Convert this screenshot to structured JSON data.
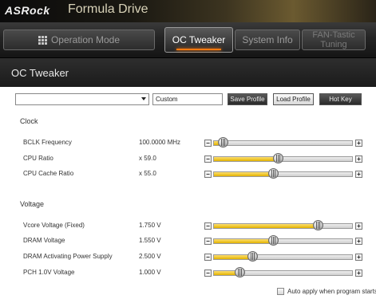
{
  "window": {
    "brand": "ASRock",
    "title": "Formula Drive"
  },
  "nav": {
    "tabs": [
      {
        "label": "Operation Mode",
        "icon": "grid-icon"
      },
      {
        "label": "OC Tweaker",
        "active": true
      },
      {
        "label": "System Info"
      },
      {
        "label_line1": "FAN-Tastic",
        "label_line2": "Tuning"
      }
    ]
  },
  "section": {
    "title": "OC Tweaker"
  },
  "profile": {
    "selected": "",
    "name_value": "Custom",
    "save_label": "Save Profile",
    "load_label": "Load Profile",
    "hotkey_label": "Hot Key"
  },
  "clock": {
    "title": "Clock",
    "rows": [
      {
        "label": "BCLK Frequency",
        "value": "100.0000 MHz",
        "level": 0.07
      },
      {
        "label": "CPU Ratio",
        "value": "x 59.0",
        "level": 0.46
      },
      {
        "label": "CPU Cache Ratio",
        "value": "x 55.0",
        "level": 0.43
      }
    ]
  },
  "voltage": {
    "title": "Voltage",
    "rows": [
      {
        "label": "Vcore Voltage (Fixed)",
        "value": "1.750 V",
        "level": 0.75
      },
      {
        "label": "DRAM Voltage",
        "value": "1.550 V",
        "level": 0.43
      },
      {
        "label": "DRAM Activating Power Supply",
        "value": "2.500 V",
        "level": 0.28
      },
      {
        "label": "PCH 1.0V Voltage",
        "value": "1.000 V",
        "level": 0.19
      }
    ]
  },
  "footer": {
    "auto_apply_label": "Auto apply when program starts",
    "auto_apply_checked": false
  },
  "colors": {
    "accent": "#ff7a10",
    "slider_fill": "#f2c200"
  }
}
